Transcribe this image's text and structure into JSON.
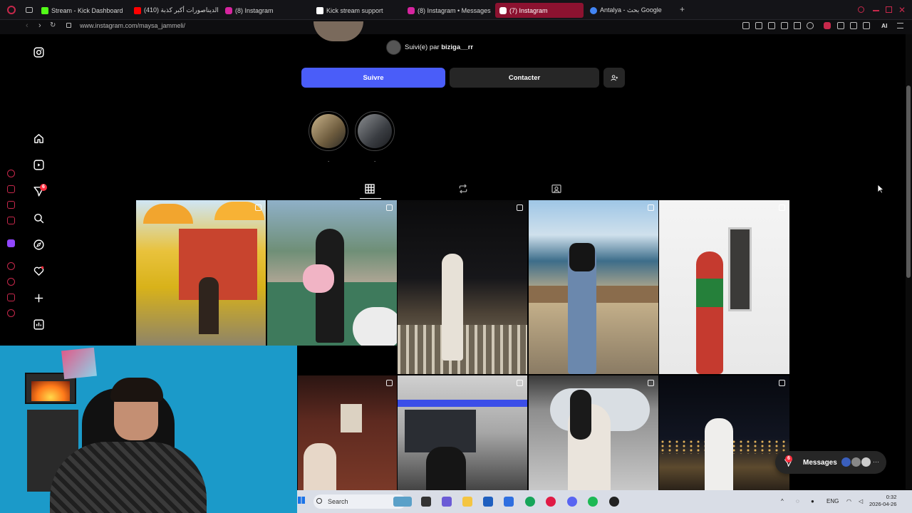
{
  "browser": {
    "tabs": [
      {
        "label": "Stream - Kick Dashboard",
        "color": "#53fc18"
      },
      {
        "label": "(410) الديناصورات أكبر كذبة",
        "color": "#ff0000"
      },
      {
        "label": "(8) Instagram",
        "color": "#d6249f"
      },
      {
        "label": "Kick stream support",
        "color": "#ffffff"
      },
      {
        "label": "(8) Instagram • Messages",
        "color": "#d6249f"
      },
      {
        "label": "(7) Instagram",
        "color": "#d6249f",
        "active": true
      },
      {
        "label": "Antalya - بحث Google",
        "color": "#4285f4"
      }
    ],
    "url": "www.instagram.com/maysa_jammeli/",
    "ai_label": "AI"
  },
  "profile": {
    "followed_by_prefix": "Suivi(e) par",
    "followed_by_user": "biziga__rr",
    "follow_label": "Suivre",
    "contact_label": "Contacter",
    "highlights": [
      {
        "label": "."
      },
      {
        "label": "."
      }
    ]
  },
  "nav": {
    "notification_count": "6"
  },
  "messages": {
    "label": "Messages",
    "badge": "6"
  },
  "taskbar": {
    "search_placeholder": "Search",
    "lang": "ENG",
    "time": "0:32",
    "date": "2026-04-26"
  },
  "colors": {
    "accent": "#4a5df9",
    "opera_red": "#c7284b",
    "badge": "#ff3040"
  }
}
